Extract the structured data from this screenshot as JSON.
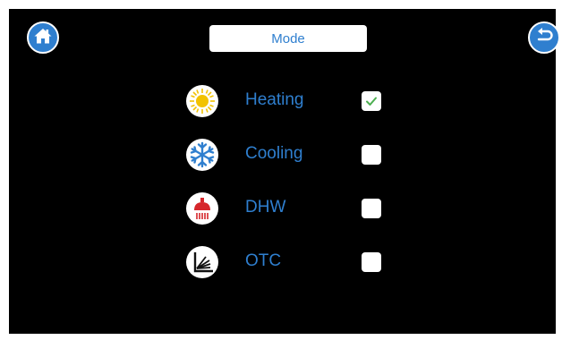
{
  "header": {
    "title": "Mode",
    "home_icon": "home-icon",
    "back_icon": "back-icon"
  },
  "modes": [
    {
      "label": "Heating",
      "icon": "sun-icon",
      "checked": true
    },
    {
      "label": "Cooling",
      "icon": "snowflake-icon",
      "checked": false
    },
    {
      "label": "DHW",
      "icon": "shower-icon",
      "checked": false
    },
    {
      "label": "OTC",
      "icon": "otc-curve-icon",
      "checked": false
    }
  ],
  "colors": {
    "background": "#000000",
    "accent": "#2f7fcf",
    "check": "#4caf50",
    "sun": "#f2c200",
    "dhw_red": "#d6262b"
  }
}
